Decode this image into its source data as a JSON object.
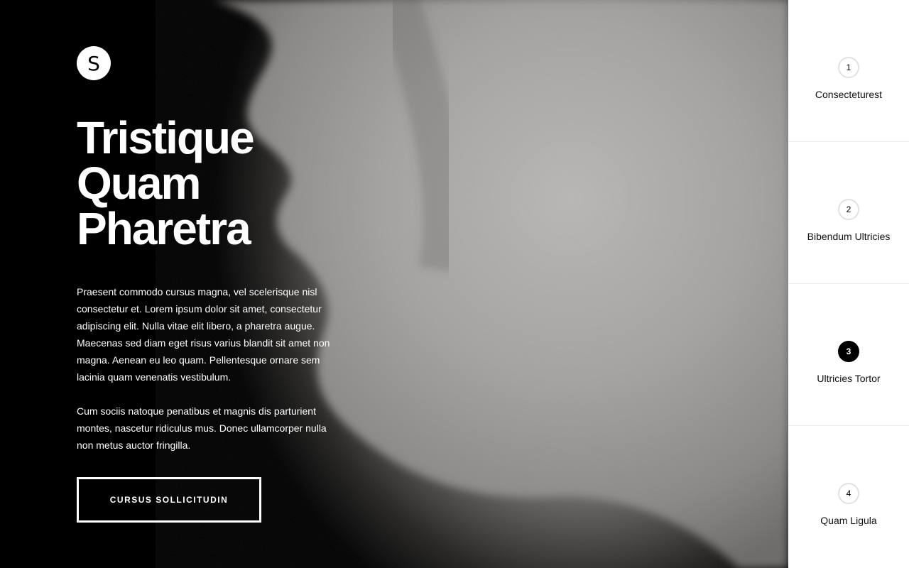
{
  "logo": {
    "letter": "S"
  },
  "hero": {
    "title_lines": [
      "Tristique",
      "Quam",
      "Pharetra"
    ],
    "paragraph_1": "Praesent commodo cursus magna, vel scelerisque nisl consectetur et. Lorem ipsum dolor sit amet, consectetur adipiscing elit. Nulla vitae elit libero, a pharetra augue. Maecenas sed diam eget risus varius blandit sit amet non magna. Aenean eu leo quam. Pellentesque ornare sem lacinia quam venenatis vestibulum.",
    "paragraph_2": "Cum sociis natoque penatibus et magnis dis parturient montes, nascetur ridiculus mus. Donec ullamcorper nulla non metus auctor fringilla.",
    "cta_label": "CURSUS SOLLICITUDIN"
  },
  "steps": [
    {
      "number": "1",
      "label": "Consecteturest",
      "active": false
    },
    {
      "number": "2",
      "label": "Bibendum Ultricies",
      "active": false
    },
    {
      "number": "3",
      "label": "Ultricies Tortor",
      "active": true
    },
    {
      "number": "4",
      "label": "Quam Ligula",
      "active": false
    }
  ],
  "colors": {
    "background": "#000000",
    "text": "#ffffff",
    "panel": "#ffffff",
    "active_step": "#000000"
  }
}
